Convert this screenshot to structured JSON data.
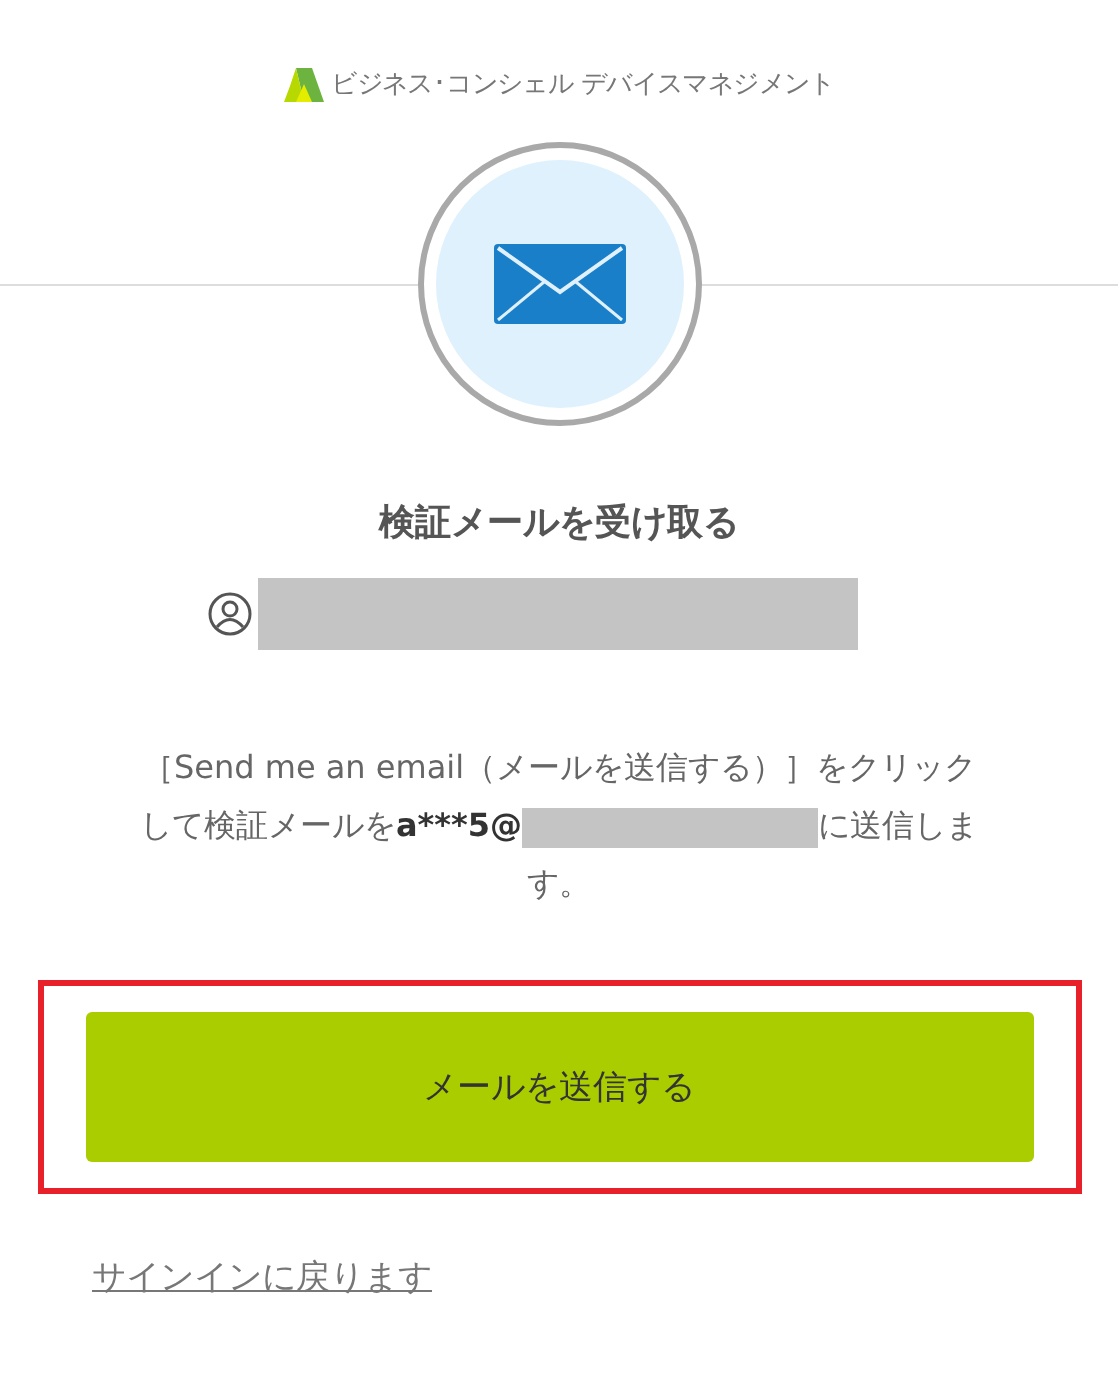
{
  "header": {
    "brand": "ビジネス･コンシェル デバイスマネジメント"
  },
  "title": "検証メールを受け取る",
  "account": {
    "redacted": true
  },
  "message": {
    "before": "［Send me an email（メールを送信する）］をクリックして検証メールを",
    "masked_email": "a***5@",
    "email_redacted": true,
    "after": "に送信します。"
  },
  "send_button": {
    "label": "メールを送信する",
    "highlighted": true
  },
  "back_link": "サインインに戻ります"
}
